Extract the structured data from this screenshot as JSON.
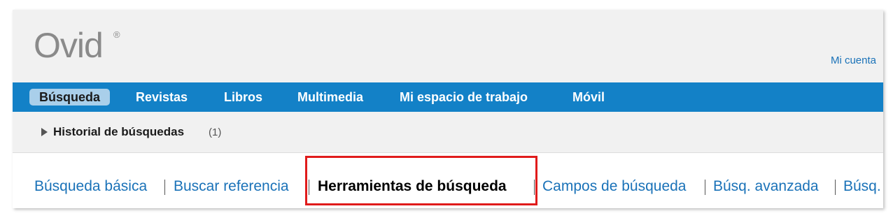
{
  "header": {
    "logo_text": "Ovid",
    "logo_mark": "®",
    "account_link": "Mi cuenta"
  },
  "nav": {
    "items": [
      {
        "label": "Búsqueda",
        "active": true
      },
      {
        "label": "Revistas"
      },
      {
        "label": "Libros"
      },
      {
        "label": "Multimedia"
      },
      {
        "label": "Mi espacio de trabajo"
      },
      {
        "label": "Móvil"
      }
    ]
  },
  "history": {
    "label": "Historial de búsquedas",
    "count": "(1)",
    "icon": "expand-triangle-icon"
  },
  "search_tabs": {
    "items": [
      {
        "label": "Búsqueda básica"
      },
      {
        "label": "Buscar referencia"
      },
      {
        "label": "Herramientas de búsqueda",
        "selected": true
      },
      {
        "label": "Campos de búsqueda"
      },
      {
        "label": "Búsq. avanzada"
      },
      {
        "label": "Búsq."
      }
    ]
  },
  "colors": {
    "nav_bar": "#1381c7",
    "active_pill": "#a9cfea",
    "link": "#1a72b8",
    "highlight": "#e01b1b",
    "header_bg": "#f1f1f1"
  }
}
